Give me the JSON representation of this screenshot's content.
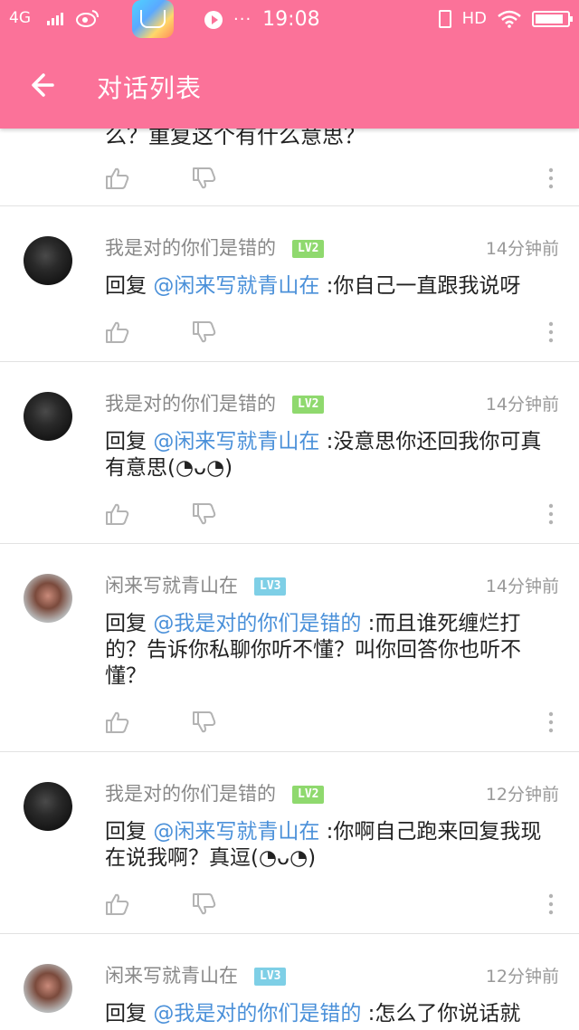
{
  "status_bar": {
    "network": "4G",
    "time": "19:08",
    "hd": "HD",
    "more_dots": "···"
  },
  "toolbar": {
    "title": "对话列表"
  },
  "partial_item": {
    "text": "么？重复这个有什么意思？"
  },
  "items": [
    {
      "username": "我是对的你们是错的",
      "level": "LV2",
      "time": "14分钟前",
      "reply_prefix": "回复 ",
      "mention": "@闲来写就青山在",
      "text": " :你自己一直跟我说呀",
      "avatar": "dark"
    },
    {
      "username": "我是对的你们是错的",
      "level": "LV2",
      "time": "14分钟前",
      "reply_prefix": "回复 ",
      "mention": "@闲来写就青山在",
      "text": " :没意思你还回我你可真有意思(◔ᴗ◔)",
      "avatar": "dark"
    },
    {
      "username": "闲来写就青山在",
      "level": "LV3",
      "time": "14分钟前",
      "reply_prefix": "回复 ",
      "mention": "@我是对的你们是错的",
      "text": " :而且谁死缠烂打的？告诉你私聊你听不懂？叫你回答你也听不懂？",
      "avatar": "bear"
    },
    {
      "username": "我是对的你们是错的",
      "level": "LV2",
      "time": "12分钟前",
      "reply_prefix": "回复 ",
      "mention": "@闲来写就青山在",
      "text": " :你啊自己跑来回复我现在说我啊？真逗(◔ᴗ◔)",
      "avatar": "dark"
    },
    {
      "username": "闲来写就青山在",
      "level": "LV3",
      "time": "12分钟前",
      "reply_prefix": "回复 ",
      "mention": "@我是对的你们是错的",
      "text": " :怎么了你说话就",
      "avatar": "bear"
    }
  ],
  "colors": {
    "brand": "#fb7299",
    "mention": "#4a90d9",
    "lv2": "#8fd96e",
    "lv3": "#7ecfe6"
  },
  "icons": {
    "back": "arrow-left-icon",
    "like": "thumbs-up-icon",
    "dislike": "thumbs-down-icon",
    "more": "more-vertical-icon"
  }
}
